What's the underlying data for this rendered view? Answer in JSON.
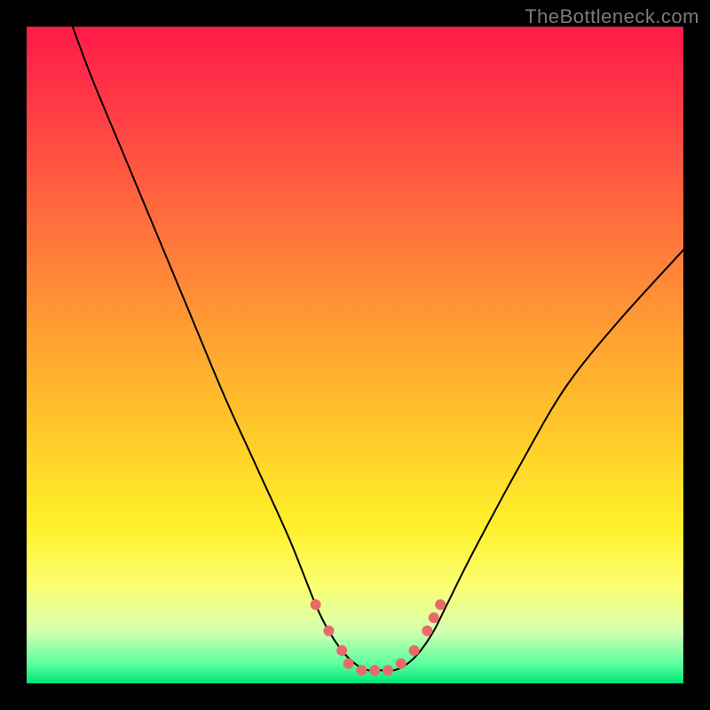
{
  "watermark": "TheBottleneck.com",
  "colors": {
    "frame": "#000000",
    "gradient_top": "#ff1a49",
    "gradient_bottom": "#00e47a",
    "curve": "#000000",
    "marker": "#e76a6a"
  },
  "chart_data": {
    "type": "line",
    "title": "",
    "xlabel": "",
    "ylabel": "",
    "xlim": [
      0,
      100
    ],
    "ylim": [
      0,
      100
    ],
    "x": [
      7,
      10,
      15,
      20,
      25,
      30,
      35,
      40,
      44,
      46,
      48,
      50,
      52,
      54,
      56,
      58,
      60,
      62,
      64,
      68,
      75,
      82,
      90,
      100
    ],
    "y": [
      100,
      92,
      80,
      68,
      56,
      44,
      33,
      22,
      12,
      8,
      5,
      3,
      2,
      2,
      2,
      3,
      5,
      8,
      12,
      20,
      33,
      45,
      55,
      66
    ],
    "series": [
      {
        "name": "bottleneck-curve",
        "x": [
          7,
          10,
          15,
          20,
          25,
          30,
          35,
          40,
          44,
          46,
          48,
          50,
          52,
          54,
          56,
          58,
          60,
          62,
          64,
          68,
          75,
          82,
          90,
          100
        ],
        "y": [
          100,
          92,
          80,
          68,
          56,
          44,
          33,
          22,
          12,
          8,
          5,
          3,
          2,
          2,
          2,
          3,
          5,
          8,
          12,
          20,
          33,
          45,
          55,
          66
        ]
      }
    ],
    "markers": [
      {
        "x": 44,
        "y": 12
      },
      {
        "x": 46,
        "y": 8
      },
      {
        "x": 48,
        "y": 5
      },
      {
        "x": 49,
        "y": 3
      },
      {
        "x": 51,
        "y": 2
      },
      {
        "x": 53,
        "y": 2
      },
      {
        "x": 55,
        "y": 2
      },
      {
        "x": 57,
        "y": 3
      },
      {
        "x": 59,
        "y": 5
      },
      {
        "x": 61,
        "y": 8
      },
      {
        "x": 62,
        "y": 10
      },
      {
        "x": 63,
        "y": 12
      }
    ]
  }
}
